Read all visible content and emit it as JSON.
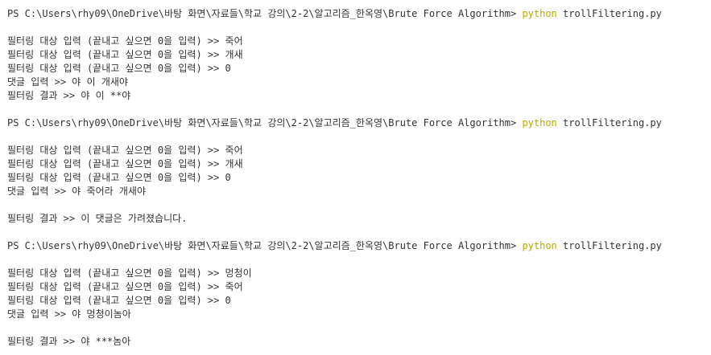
{
  "terminal": {
    "colors": {
      "text": "#333333",
      "command": "#b3ad00",
      "background": "#ffffff"
    },
    "sessions": [
      {
        "prompt": "PS C:\\Users\\rhy09\\OneDrive\\바탕 화면\\자료들\\학교 강의\\2-2\\알고리즘_한옥영\\Brute Force Algorithm> ",
        "command": "python",
        "args": " trollFiltering.py",
        "inputs": [
          "필터링 대상 입력 (끝내고 싶으면 0을 입력) >> 죽어",
          "필터링 대상 입력 (끝내고 싶으면 0을 입력) >> 개새",
          "필터링 대상 입력 (끝내고 싶으면 0을 입력) >> 0",
          "댓글 입력 >> 야 이 개새야"
        ],
        "result": "필터링 결과 >> 야 이 **야"
      },
      {
        "prompt": "PS C:\\Users\\rhy09\\OneDrive\\바탕 화면\\자료들\\학교 강의\\2-2\\알고리즘_한옥영\\Brute Force Algorithm> ",
        "command": "python",
        "args": " trollFiltering.py",
        "inputs": [
          "필터링 대상 입력 (끝내고 싶으면 0을 입력) >> 죽어",
          "필터링 대상 입력 (끝내고 싶으면 0을 입력) >> 개새",
          "필터링 대상 입력 (끝내고 싶으면 0을 입력) >> 0",
          "댓글 입력 >> 야 죽어라 개새야"
        ],
        "result": "필터링 결과 >> 이 댓글은 가려졌습니다."
      },
      {
        "prompt": "PS C:\\Users\\rhy09\\OneDrive\\바탕 화면\\자료들\\학교 강의\\2-2\\알고리즘_한옥영\\Brute Force Algorithm> ",
        "command": "python",
        "args": " trollFiltering.py",
        "inputs": [
          "필터링 대상 입력 (끝내고 싶으면 0을 입력) >> 멍청이",
          "필터링 대상 입력 (끝내고 싶으면 0을 입력) >> 죽어",
          "필터링 대상 입력 (끝내고 싶으면 0을 입력) >> 0",
          "댓글 입력 >> 야 멍청이놈아"
        ],
        "result": "필터링 결과 >> 야 ***놈아"
      }
    ]
  }
}
